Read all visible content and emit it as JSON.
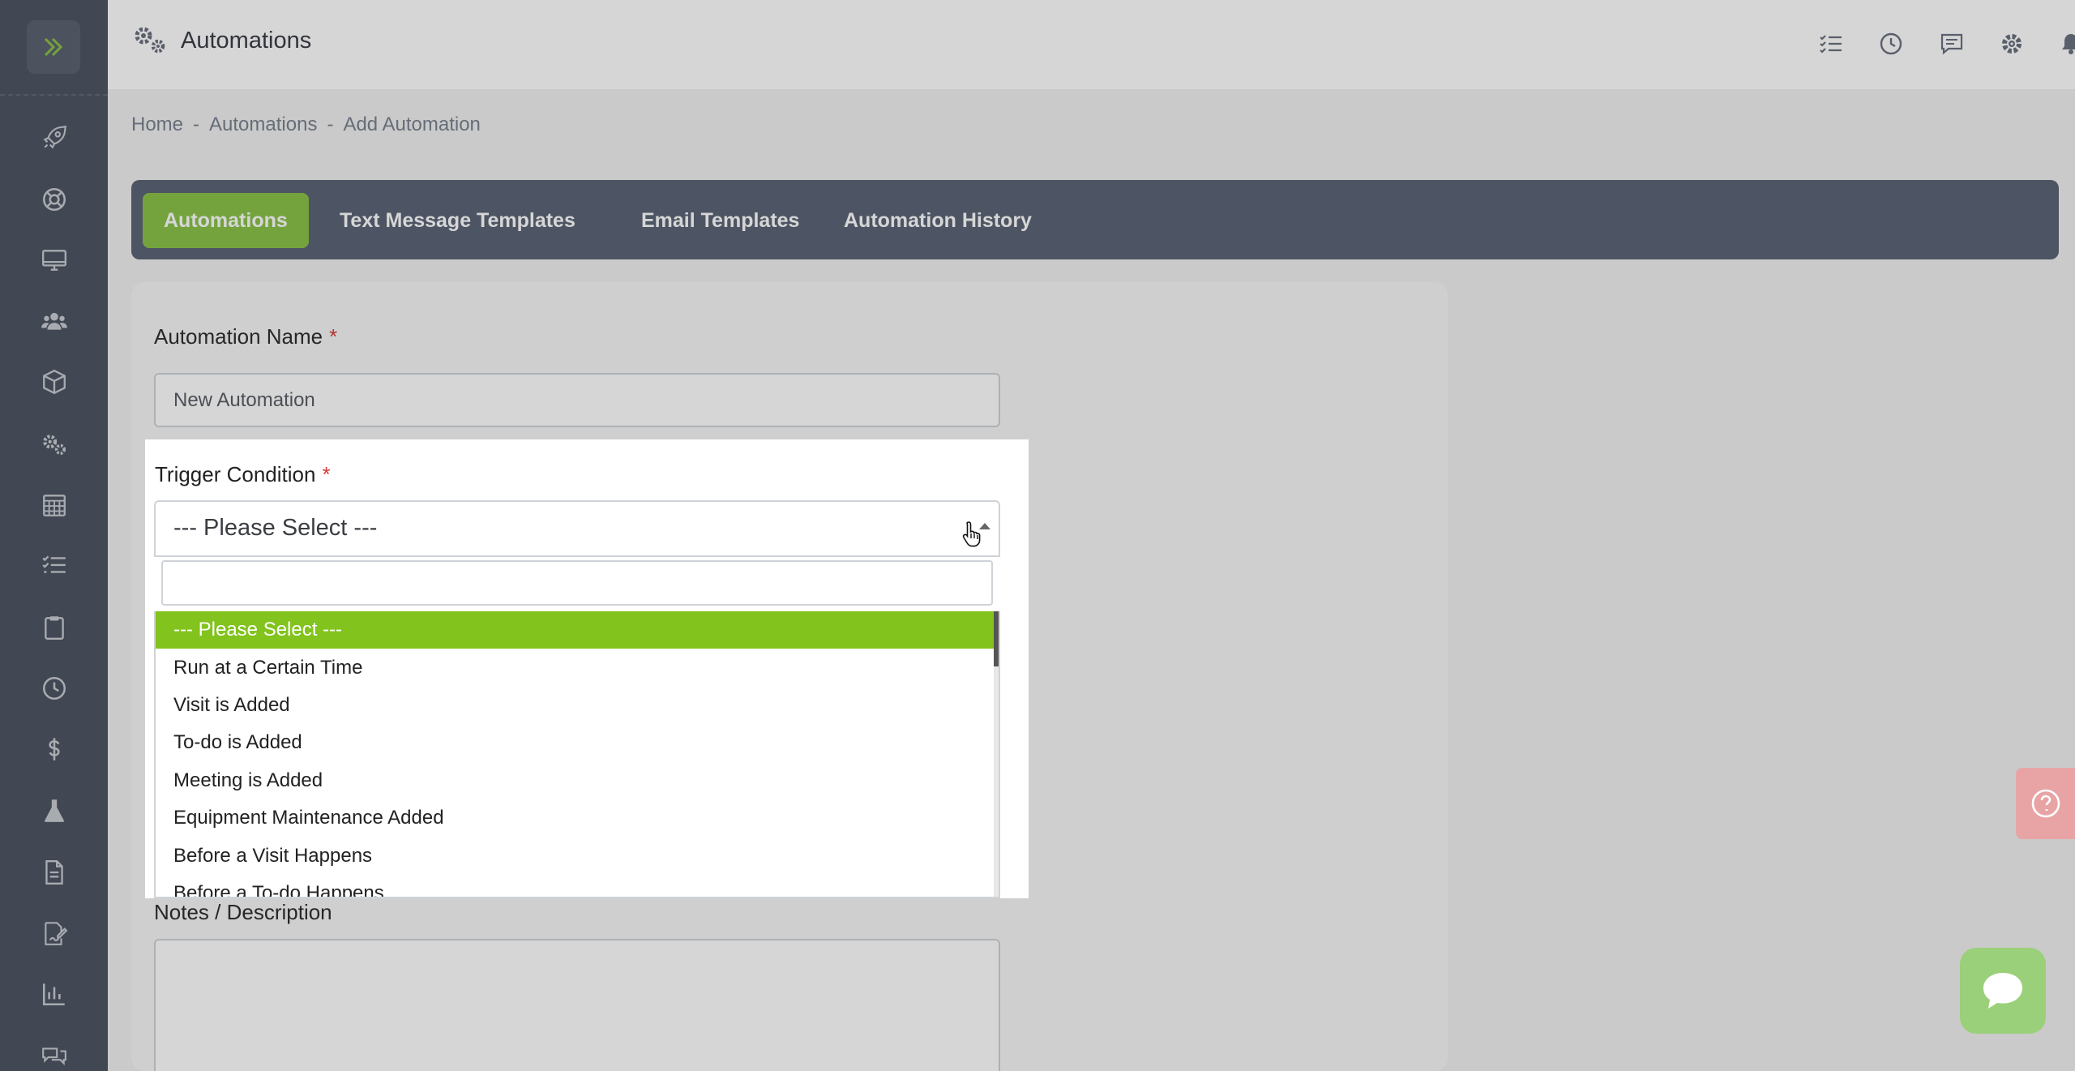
{
  "header": {
    "title": "Automations"
  },
  "breadcrumb": {
    "home": "Home",
    "sep": "-",
    "section": "Automations",
    "current": "Add Automation"
  },
  "tabs": [
    {
      "label": "Automations",
      "active": true
    },
    {
      "label": "Text Message Templates"
    },
    {
      "label": "Email Templates"
    },
    {
      "label": "Automation History"
    }
  ],
  "form": {
    "name_label": "Automation Name",
    "required_mark": "*",
    "name_value": "New Automation",
    "trigger_label": "Trigger Condition",
    "trigger_selected": "--- Please Select ---",
    "search_placeholder": "",
    "notes_label": "Notes / Description"
  },
  "trigger_options": [
    "--- Please Select ---",
    "Run at a Certain Time",
    "Visit is Added",
    "To-do is Added",
    "Meeting is Added",
    "Equipment Maintenance Added",
    "Before a Visit Happens",
    "Before a To-do Happens"
  ],
  "icons": {
    "sidebar": [
      "double-chevron-right-icon",
      "rocket-icon",
      "lifebuoy-icon",
      "monitor-icon",
      "users-icon",
      "cube-icon",
      "gears-icon",
      "calendar-icon",
      "checklist-icon",
      "clipboard-icon",
      "clock-icon",
      "dollar-icon",
      "flask-icon",
      "document-icon",
      "signature-icon",
      "bar-chart-icon",
      "chat-bubbles-icon"
    ],
    "header": [
      "checklist-icon",
      "history-icon",
      "message-icon",
      "gear-icon",
      "bell-icon",
      "user-icon"
    ]
  },
  "colors": {
    "accent": "#8bc34a",
    "selected_option": "#82c31e",
    "sidebar": "#4e5563",
    "tabbar": "#5c6577",
    "required": "#d93a3a"
  }
}
